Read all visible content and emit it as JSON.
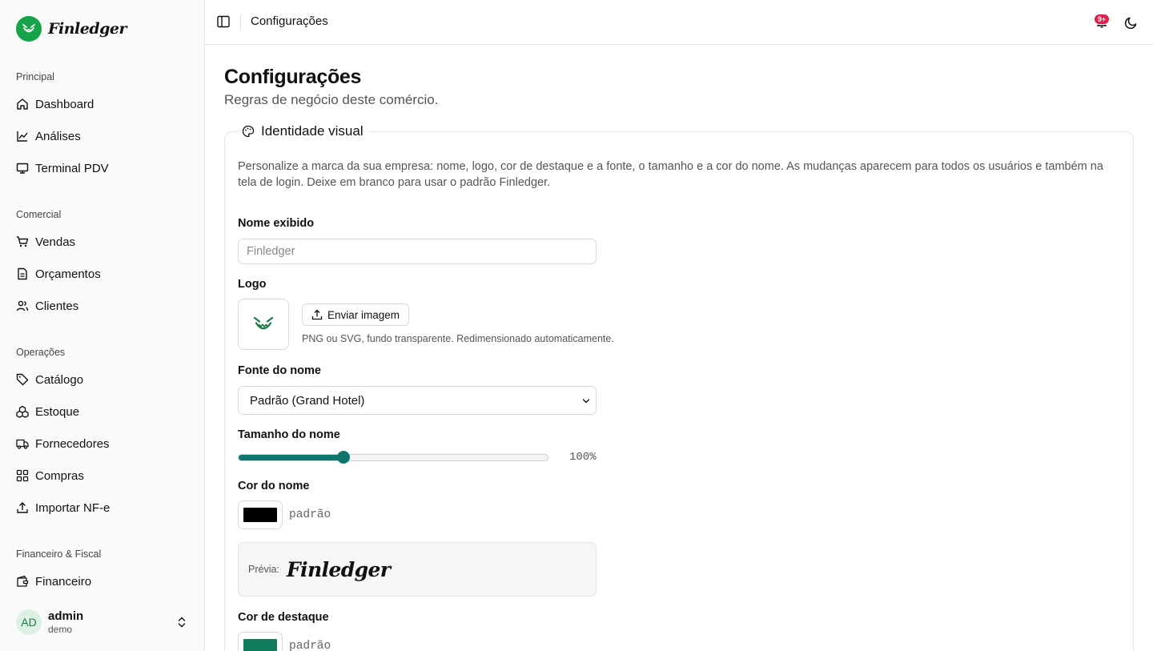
{
  "brand": {
    "name": "Finledger"
  },
  "sidebar": {
    "groups": [
      {
        "label": "Principal",
        "items": [
          {
            "label": "Dashboard",
            "icon": "home-icon"
          },
          {
            "label": "Análises",
            "icon": "chart-line-icon"
          },
          {
            "label": "Terminal PDV",
            "icon": "monitor-icon"
          }
        ]
      },
      {
        "label": "Comercial",
        "items": [
          {
            "label": "Vendas",
            "icon": "cart-icon"
          },
          {
            "label": "Orçamentos",
            "icon": "document-icon"
          },
          {
            "label": "Clientes",
            "icon": "users-icon"
          }
        ]
      },
      {
        "label": "Operações",
        "items": [
          {
            "label": "Catálogo",
            "icon": "tag-icon"
          },
          {
            "label": "Estoque",
            "icon": "boxes-icon"
          },
          {
            "label": "Fornecedores",
            "icon": "truck-icon"
          },
          {
            "label": "Compras",
            "icon": "grid-icon"
          },
          {
            "label": "Importar NF-e",
            "icon": "upload-icon"
          }
        ]
      },
      {
        "label": "Financeiro & Fiscal",
        "items": [
          {
            "label": "Financeiro",
            "icon": "wallet-icon"
          }
        ]
      }
    ],
    "user": {
      "initials": "AD",
      "name": "admin",
      "org": "demo"
    }
  },
  "topbar": {
    "title": "Configurações",
    "notifications_badge": "9+"
  },
  "page": {
    "title": "Configurações",
    "subtitle": "Regras de negócio deste comércio."
  },
  "identity": {
    "legend": "Identidade visual",
    "intro": "Personalize a marca da sua empresa: nome, logo, cor de destaque e a fonte, o tamanho e a cor do nome. As mudanças aparecem para todos os usuários e também na tela de login. Deixe em branco para usar o padrão Finledger.",
    "display_name": {
      "label": "Nome exibido",
      "value": "",
      "placeholder": "Finledger"
    },
    "logo": {
      "label": "Logo",
      "upload_label": "Enviar imagem",
      "hint": "PNG ou SVG, fundo transparente. Redimensionado automaticamente."
    },
    "font": {
      "label": "Fonte do nome",
      "selected": "Padrão (Grand Hotel)"
    },
    "size": {
      "label": "Tamanho do nome",
      "value_text": "100%",
      "slider_fraction": 0.34
    },
    "name_color": {
      "label": "Cor do nome",
      "swatch": "#000000",
      "value_text": "padrão"
    },
    "preview": {
      "label": "Prévia:",
      "name": "Finledger"
    },
    "accent_color": {
      "label": "Cor de destaque",
      "swatch": "#0f7a5c",
      "value_text": "padrão"
    }
  },
  "colors": {
    "brand": "#16a34a",
    "accent": "#0f766e",
    "badge": "#e11d48"
  }
}
